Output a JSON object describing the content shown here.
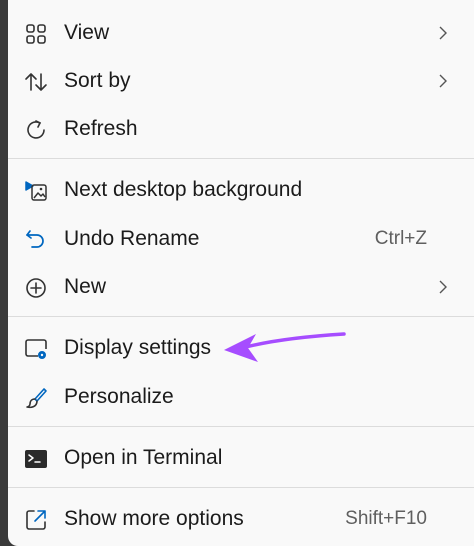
{
  "menu": {
    "items": [
      {
        "label": "View",
        "icon": "grid-view-icon",
        "has_submenu": true
      },
      {
        "label": "Sort by",
        "icon": "sort-arrows-icon",
        "has_submenu": true
      },
      {
        "label": "Refresh",
        "icon": "refresh-icon",
        "has_submenu": false
      },
      {
        "label": "Next desktop background",
        "icon": "slideshow-image-icon",
        "has_submenu": false
      },
      {
        "label": "Undo Rename",
        "icon": "undo-icon",
        "shortcut": "Ctrl+Z",
        "has_submenu": false
      },
      {
        "label": "New",
        "icon": "plus-circle-icon",
        "has_submenu": true
      },
      {
        "label": "Display settings",
        "icon": "display-settings-icon",
        "has_submenu": false
      },
      {
        "label": "Personalize",
        "icon": "paintbrush-icon",
        "has_submenu": false
      },
      {
        "label": "Open in Terminal",
        "icon": "terminal-icon",
        "has_submenu": false
      },
      {
        "label": "Show more options",
        "icon": "open-external-icon",
        "shortcut": "Shift+F10",
        "has_submenu": false
      }
    ]
  },
  "colors": {
    "menu_background": "#f9f9f9",
    "accent_icon": "#0067c0",
    "annotation_arrow": "#a64dff",
    "text": "#1b1b1b"
  }
}
